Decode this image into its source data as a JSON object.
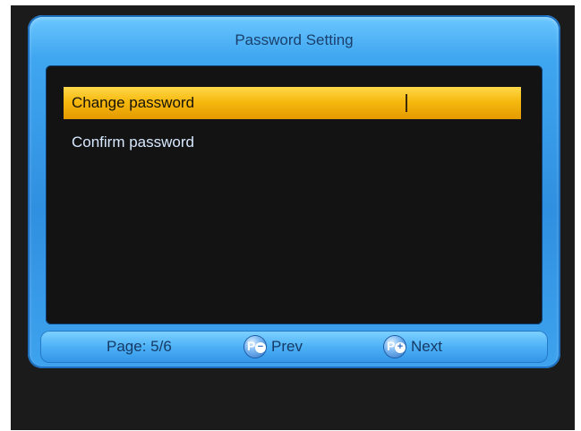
{
  "dialog": {
    "title": "Password Setting"
  },
  "rows": [
    {
      "label": "Change password",
      "selected": true
    },
    {
      "label": "Confirm password",
      "selected": false
    }
  ],
  "footer": {
    "page": "Page: 5/6",
    "prev_label": "Prev",
    "next_label": "Next",
    "prev_key": "P-",
    "next_key": "P+"
  },
  "colors": {
    "accent_selected": "#f6b90f",
    "frame_blue": "#3fa6f0",
    "panel_bg": "#131313"
  }
}
